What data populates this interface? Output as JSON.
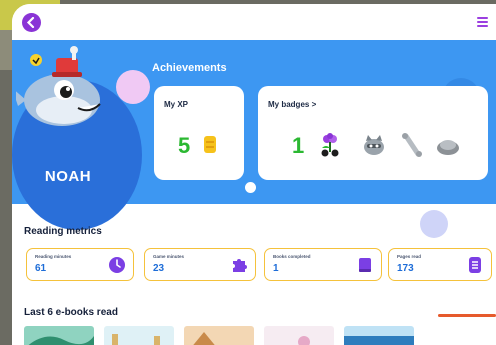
{
  "achievements": {
    "title": "Achievements",
    "xp_label": "My XP",
    "xp_value": "5",
    "badges_label": "My badges >",
    "badges_count": "1",
    "badge_icons": [
      "flower-badge-icon",
      "raccoon-badge-icon",
      "bone-badge-icon",
      "boulder-badge-icon"
    ]
  },
  "profile": {
    "name": "NOAH"
  },
  "reading_metrics": {
    "title": "Reading metrics",
    "items": [
      {
        "label": "Reading minutes",
        "value": "61",
        "icon": "clock-icon",
        "color": "#7b3fe4"
      },
      {
        "label": "Game minutes",
        "value": "23",
        "icon": "puzzle-icon",
        "color": "#7b3fe4"
      },
      {
        "label": "Books completed",
        "value": "1",
        "icon": "book-icon",
        "color": "#7b3fe4"
      },
      {
        "label": "Pages read",
        "value": "173",
        "icon": "pages-icon",
        "color": "#7b3fe4"
      }
    ]
  },
  "ebooks": {
    "title": "Last 6 e-books read"
  },
  "colors": {
    "hero": "#3d97f2",
    "accent": "#8a34d6",
    "xp_green": "#2bb832",
    "metric_border": "#f5c23b"
  }
}
